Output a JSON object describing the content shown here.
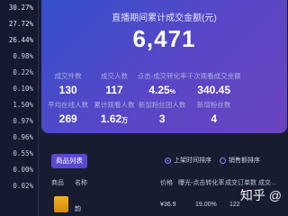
{
  "sidebar": {
    "items": [
      "30.27%",
      "27.72%",
      "26.44%",
      "0.98%",
      "0.22%",
      "0.10%",
      "1.50%",
      "0.97%",
      "0.96%",
      "0.55%",
      "0.00%",
      "0.02%"
    ]
  },
  "hero": {
    "title": "直播期间累计成交金额(元)",
    "total": "6,471",
    "metrics": [
      {
        "label": "成交件数",
        "value": "130",
        "unit": ""
      },
      {
        "label": "成交人数",
        "value": "117",
        "unit": ""
      },
      {
        "label": "点击-成交转化率",
        "value": "4.25",
        "unit": "%"
      },
      {
        "label": "千次观看成交金额",
        "value": "340.45",
        "unit": ""
      },
      {
        "label": "平均在线人数",
        "value": "269",
        "unit": ""
      },
      {
        "label": "累计观看人数",
        "value": "1.62",
        "unit": "万"
      },
      {
        "label": "新加粉丝团人数",
        "value": "3",
        "unit": ""
      },
      {
        "label": "新增粉丝数",
        "value": "4",
        "unit": ""
      }
    ]
  },
  "goods": {
    "button": "商品列表",
    "sort_options": [
      "上架时间排序",
      "销售额排序"
    ],
    "selected_sort": "上架时间排序",
    "columns": [
      "商品",
      "名称",
      "价格",
      "曝光-点击转化率",
      "成交订单数",
      "成交..."
    ],
    "row": {
      "name_prefix": "韵",
      "price": "¥36.9",
      "conversion": "19.00%",
      "orders": "122"
    }
  },
  "watermark": "知乎 @"
}
